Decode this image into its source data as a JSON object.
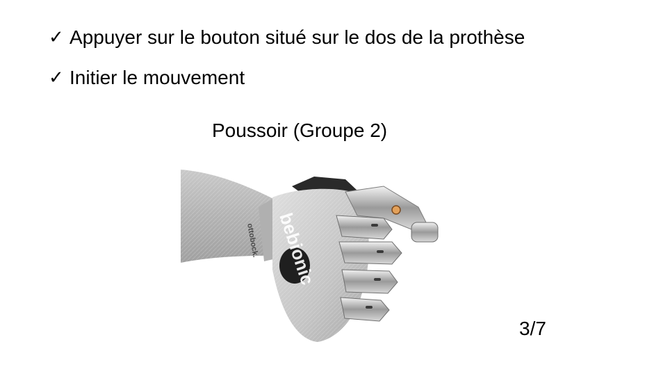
{
  "bullets": [
    {
      "icon": "checkmark-icon",
      "symbol": "✓",
      "text": "Appuyer sur le bouton situé sur le dos de la prothèse"
    },
    {
      "icon": "checkmark-icon",
      "symbol": "✓",
      "text": "Initier le mouvement"
    }
  ],
  "figure": {
    "caption": "Poussoir (Groupe 2)",
    "brand_text": "bebionic",
    "maker_text": "ottobock."
  },
  "slide_number": "3/7"
}
